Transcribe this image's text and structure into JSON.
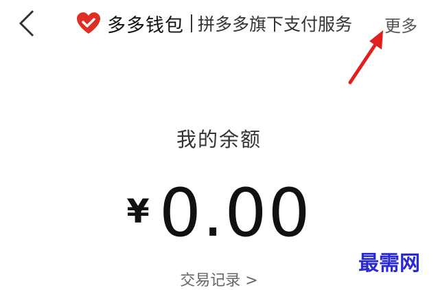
{
  "header": {
    "back_icon": "chevron-left-icon",
    "brand_icon": "heart-check-icon",
    "brand_color": "#e02e24",
    "brand_name": "多多钱包",
    "subtitle": "拼多多旗下支付服务",
    "more_label": "更多"
  },
  "annotation": {
    "arrow_color": "#e02020"
  },
  "balance": {
    "label": "我的余额",
    "currency": "¥",
    "amount": "0.00"
  },
  "records": {
    "label": "交易记录 >"
  },
  "watermark": {
    "text": "最需网",
    "color": "#2929d6"
  }
}
